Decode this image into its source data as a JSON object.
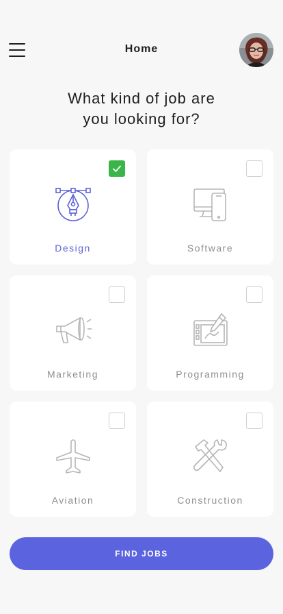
{
  "header": {
    "title": "Home",
    "menu_icon": "hamburger-menu-icon",
    "avatar_icon": "user-avatar"
  },
  "heading": {
    "line1": "What kind of job are",
    "line2": "you looking for?"
  },
  "categories": [
    {
      "label": "Design",
      "icon": "pen-tool-icon",
      "checked": true
    },
    {
      "label": "Software",
      "icon": "devices-icon",
      "checked": false
    },
    {
      "label": "Marketing",
      "icon": "megaphone-icon",
      "checked": false
    },
    {
      "label": "Programming",
      "icon": "drawing-tablet-icon",
      "checked": false
    },
    {
      "label": "Aviation",
      "icon": "airplane-icon",
      "checked": false
    },
    {
      "label": "Construction",
      "icon": "tools-icon",
      "checked": false
    }
  ],
  "find_button": {
    "label": "FIND JOBS"
  },
  "colors": {
    "accent": "#5b63df",
    "check_green": "#39b54a",
    "text_dark": "#1d1d1f",
    "text_muted": "#8e8e8e",
    "icon_gray": "#b5b5b5"
  }
}
